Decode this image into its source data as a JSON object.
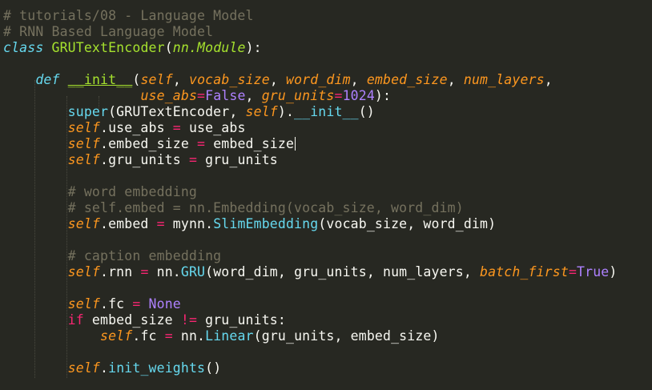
{
  "editor": {
    "theme_colors": {
      "background": "#272822",
      "foreground": "#f8f8f2",
      "comment": "#75715e",
      "keyword": "#66d9ef",
      "self_param": "#fd971f",
      "constant": "#ae81ff",
      "operator": "#f92672",
      "class_name": "#a6e22e"
    },
    "cursor_line": 10,
    "lines": [
      [
        {
          "t": "# tutorials/08 - Language Model",
          "c": "comment"
        }
      ],
      [
        {
          "t": "# RNN Based Language Model",
          "c": "comment"
        }
      ],
      [
        {
          "t": "class",
          "c": "keyword"
        },
        {
          "t": " ",
          "c": "plain"
        },
        {
          "t": "GRUTextEncoder",
          "c": "classname"
        },
        {
          "t": "(",
          "c": "plain"
        },
        {
          "t": "nn.Module",
          "c": "inherit"
        },
        {
          "t": "):",
          "c": "plain"
        }
      ],
      [],
      [
        {
          "t": "    ",
          "c": "plain"
        },
        {
          "t": "def",
          "c": "keyword"
        },
        {
          "t": " ",
          "c": "plain"
        },
        {
          "t": "__init__",
          "c": "func"
        },
        {
          "t": "(",
          "c": "plain"
        },
        {
          "t": "self",
          "c": "param"
        },
        {
          "t": ", ",
          "c": "plain"
        },
        {
          "t": "vocab_size",
          "c": "param"
        },
        {
          "t": ", ",
          "c": "plain"
        },
        {
          "t": "word_dim",
          "c": "param"
        },
        {
          "t": ", ",
          "c": "plain"
        },
        {
          "t": "embed_size",
          "c": "param"
        },
        {
          "t": ", ",
          "c": "plain"
        },
        {
          "t": "num_layers",
          "c": "param"
        },
        {
          "t": ",",
          "c": "plain"
        }
      ],
      [
        {
          "t": "                 ",
          "c": "plain"
        },
        {
          "t": "use_abs",
          "c": "param"
        },
        {
          "t": "=",
          "c": "operator"
        },
        {
          "t": "False",
          "c": "constant"
        },
        {
          "t": ", ",
          "c": "plain"
        },
        {
          "t": "gru_units",
          "c": "param"
        },
        {
          "t": "=",
          "c": "operator"
        },
        {
          "t": "1024",
          "c": "constant"
        },
        {
          "t": "):",
          "c": "plain"
        }
      ],
      [
        {
          "t": "        ",
          "c": "plain"
        },
        {
          "t": "super",
          "c": "builtin"
        },
        {
          "t": "(GRUTextEncoder, ",
          "c": "plain"
        },
        {
          "t": "self",
          "c": "self"
        },
        {
          "t": ").",
          "c": "plain"
        },
        {
          "t": "__init__",
          "c": "call"
        },
        {
          "t": "()",
          "c": "plain"
        }
      ],
      [
        {
          "t": "        ",
          "c": "plain"
        },
        {
          "t": "self",
          "c": "self"
        },
        {
          "t": ".use_abs ",
          "c": "plain"
        },
        {
          "t": "=",
          "c": "operator"
        },
        {
          "t": " use_abs",
          "c": "plain"
        }
      ],
      [
        {
          "t": "        ",
          "c": "plain"
        },
        {
          "t": "self",
          "c": "self"
        },
        {
          "t": ".embed_size ",
          "c": "plain"
        },
        {
          "t": "=",
          "c": "operator"
        },
        {
          "t": " embed_size",
          "c": "plain"
        }
      ],
      [
        {
          "t": "        ",
          "c": "plain"
        },
        {
          "t": "self",
          "c": "self"
        },
        {
          "t": ".gru_units ",
          "c": "plain"
        },
        {
          "t": "=",
          "c": "operator"
        },
        {
          "t": " gru_units",
          "c": "plain"
        }
      ],
      [],
      [
        {
          "t": "        ",
          "c": "plain"
        },
        {
          "t": "# word embedding",
          "c": "comment"
        }
      ],
      [
        {
          "t": "        ",
          "c": "plain"
        },
        {
          "t": "# self.embed = nn.Embedding(vocab_size, word_dim)",
          "c": "comment"
        }
      ],
      [
        {
          "t": "        ",
          "c": "plain"
        },
        {
          "t": "self",
          "c": "self"
        },
        {
          "t": ".embed ",
          "c": "plain"
        },
        {
          "t": "=",
          "c": "operator"
        },
        {
          "t": " mynn.",
          "c": "plain"
        },
        {
          "t": "SlimEmbedding",
          "c": "call"
        },
        {
          "t": "(vocab_size, word_dim)",
          "c": "plain"
        }
      ],
      [],
      [
        {
          "t": "        ",
          "c": "plain"
        },
        {
          "t": "# caption embedding",
          "c": "comment"
        }
      ],
      [
        {
          "t": "        ",
          "c": "plain"
        },
        {
          "t": "self",
          "c": "self"
        },
        {
          "t": ".rnn ",
          "c": "plain"
        },
        {
          "t": "=",
          "c": "operator"
        },
        {
          "t": " nn.",
          "c": "plain"
        },
        {
          "t": "GRU",
          "c": "call"
        },
        {
          "t": "(word_dim, gru_units, num_layers, ",
          "c": "plain"
        },
        {
          "t": "batch_first",
          "c": "param"
        },
        {
          "t": "=",
          "c": "operator"
        },
        {
          "t": "True",
          "c": "constant"
        },
        {
          "t": ")",
          "c": "plain"
        }
      ],
      [],
      [
        {
          "t": "        ",
          "c": "plain"
        },
        {
          "t": "self",
          "c": "self"
        },
        {
          "t": ".fc ",
          "c": "plain"
        },
        {
          "t": "=",
          "c": "operator"
        },
        {
          "t": " ",
          "c": "plain"
        },
        {
          "t": "None",
          "c": "constant"
        }
      ],
      [
        {
          "t": "        ",
          "c": "plain"
        },
        {
          "t": "if",
          "c": "operator"
        },
        {
          "t": " embed_size ",
          "c": "plain"
        },
        {
          "t": "!=",
          "c": "operator"
        },
        {
          "t": " gru_units:",
          "c": "plain"
        }
      ],
      [
        {
          "t": "            ",
          "c": "plain"
        },
        {
          "t": "self",
          "c": "self"
        },
        {
          "t": ".fc ",
          "c": "plain"
        },
        {
          "t": "=",
          "c": "operator"
        },
        {
          "t": " nn.",
          "c": "plain"
        },
        {
          "t": "Linear",
          "c": "call"
        },
        {
          "t": "(gru_units, embed_size)",
          "c": "plain"
        }
      ],
      [],
      [
        {
          "t": "        ",
          "c": "plain"
        },
        {
          "t": "self",
          "c": "self"
        },
        {
          "t": ".",
          "c": "plain"
        },
        {
          "t": "init_weights",
          "c": "call"
        },
        {
          "t": "()",
          "c": "plain"
        }
      ]
    ]
  }
}
